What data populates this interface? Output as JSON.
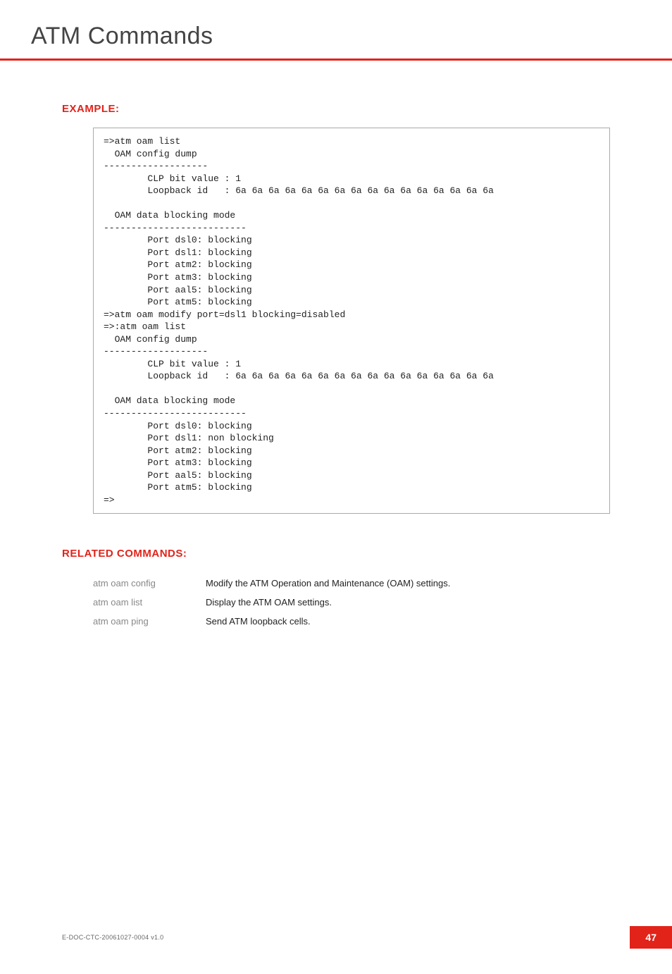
{
  "title": "ATM Commands",
  "example": {
    "heading": "EXAMPLE:",
    "code": "=>atm oam list\n  OAM config dump\n-------------------\n        CLP bit value : 1\n        Loopback id   : 6a 6a 6a 6a 6a 6a 6a 6a 6a 6a 6a 6a 6a 6a 6a 6a\n\n  OAM data blocking mode\n--------------------------\n        Port dsl0: blocking\n        Port dsl1: blocking\n        Port atm2: blocking\n        Port atm3: blocking\n        Port aal5: blocking\n        Port atm5: blocking\n=>atm oam modify port=dsl1 blocking=disabled\n=>:atm oam list\n  OAM config dump\n-------------------\n        CLP bit value : 1\n        Loopback id   : 6a 6a 6a 6a 6a 6a 6a 6a 6a 6a 6a 6a 6a 6a 6a 6a\n\n  OAM data blocking mode\n--------------------------\n        Port dsl0: blocking\n        Port dsl1: non blocking\n        Port atm2: blocking\n        Port atm3: blocking\n        Port aal5: blocking\n        Port atm5: blocking\n=>"
  },
  "related": {
    "heading": "RELATED COMMANDS:",
    "items": [
      {
        "cmd": "atm oam config",
        "desc": "Modify the ATM Operation and Maintenance (OAM) settings."
      },
      {
        "cmd": "atm oam list",
        "desc": "Display the ATM OAM settings."
      },
      {
        "cmd": "atm oam ping",
        "desc": "Send ATM loopback cells."
      }
    ]
  },
  "footer": {
    "doc_id": "E-DOC-CTC-20061027-0004 v1.0",
    "page_number": "47"
  }
}
